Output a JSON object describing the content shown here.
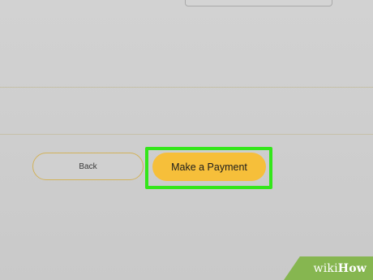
{
  "buttons": {
    "back_label": "Back",
    "payment_label": "Make a Payment"
  },
  "watermark": {
    "wiki": "wiki",
    "how": "How"
  },
  "colors": {
    "highlight": "#33e61a",
    "payment_button": "#f6bf3a",
    "back_border": "#d2b25a",
    "watermark_bg": "#86b650"
  }
}
